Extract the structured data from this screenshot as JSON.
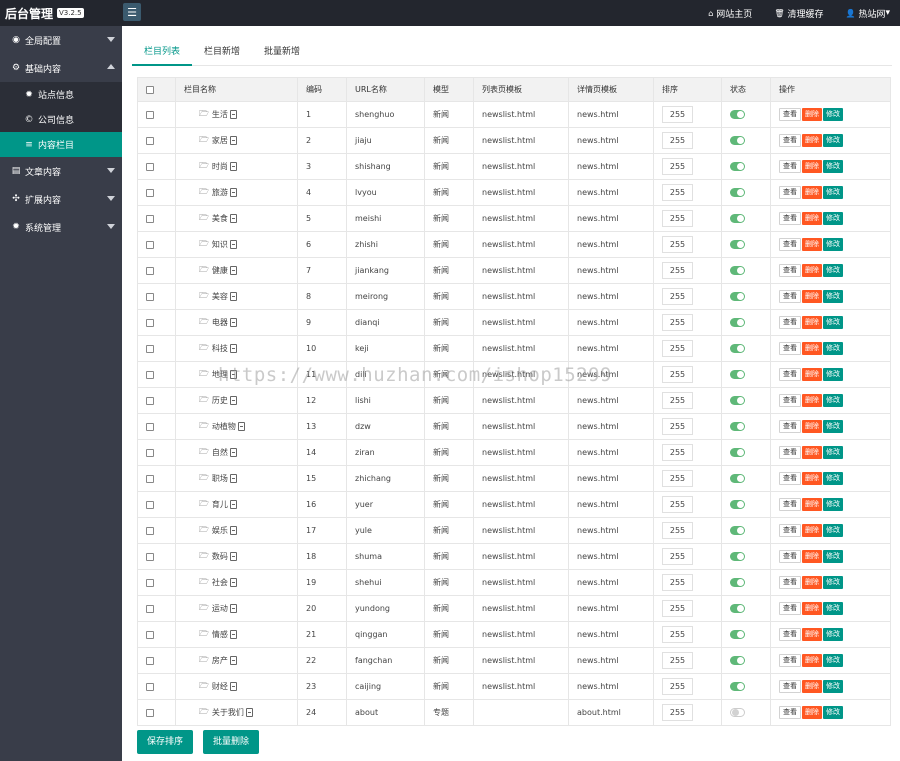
{
  "header": {
    "title": "后台管理",
    "version": "V3.2.5",
    "links": [
      {
        "icon": "home-icon",
        "glyph": "⌂",
        "label": "网站主页"
      },
      {
        "icon": "trash-icon",
        "glyph": "🗑",
        "label": "清理缓存"
      },
      {
        "icon": "user-icon",
        "glyph": "👤",
        "label": "热站网"
      }
    ]
  },
  "sidebar": {
    "items": [
      {
        "label": "全局配置",
        "icon": "globe-icon",
        "glyph": "◉",
        "expanded": false
      },
      {
        "label": "基础内容",
        "icon": "sliders-icon",
        "glyph": "⚙",
        "expanded": true,
        "children": [
          {
            "label": "站点信息",
            "icon": "gear-icon",
            "glyph": "✹",
            "active": false
          },
          {
            "label": "公司信息",
            "icon": "copyright-icon",
            "glyph": "©",
            "active": false
          },
          {
            "label": "内容栏目",
            "icon": "list-icon",
            "glyph": "≡",
            "active": true
          }
        ]
      },
      {
        "label": "文章内容",
        "icon": "file-icon",
        "glyph": "▤",
        "expanded": false
      },
      {
        "label": "扩展内容",
        "icon": "expand-icon",
        "glyph": "✣",
        "expanded": false
      },
      {
        "label": "系统管理",
        "icon": "cog-icon",
        "glyph": "✹",
        "expanded": false
      }
    ]
  },
  "tabs": [
    "栏目列表",
    "栏目新增",
    "批量新增"
  ],
  "table": {
    "headers": [
      "栏目名称",
      "编码",
      "URL名称",
      "模型",
      "列表页模板",
      "详情页模板",
      "排序",
      "状态",
      "操作"
    ],
    "actions": {
      "view": "查看",
      "delete": "删除",
      "edit": "修改"
    },
    "rows": [
      {
        "name": "生活",
        "code": "1",
        "url": "shenghuo",
        "model": "新闻",
        "list_tpl": "newslist.html",
        "detail_tpl": "news.html",
        "sort": "255",
        "enabled": true
      },
      {
        "name": "家居",
        "code": "2",
        "url": "jiaju",
        "model": "新闻",
        "list_tpl": "newslist.html",
        "detail_tpl": "news.html",
        "sort": "255",
        "enabled": true
      },
      {
        "name": "时尚",
        "code": "3",
        "url": "shishang",
        "model": "新闻",
        "list_tpl": "newslist.html",
        "detail_tpl": "news.html",
        "sort": "255",
        "enabled": true
      },
      {
        "name": "旅游",
        "code": "4",
        "url": "lvyou",
        "model": "新闻",
        "list_tpl": "newslist.html",
        "detail_tpl": "news.html",
        "sort": "255",
        "enabled": true
      },
      {
        "name": "美食",
        "code": "5",
        "url": "meishi",
        "model": "新闻",
        "list_tpl": "newslist.html",
        "detail_tpl": "news.html",
        "sort": "255",
        "enabled": true
      },
      {
        "name": "知识",
        "code": "6",
        "url": "zhishi",
        "model": "新闻",
        "list_tpl": "newslist.html",
        "detail_tpl": "news.html",
        "sort": "255",
        "enabled": true
      },
      {
        "name": "健康",
        "code": "7",
        "url": "jiankang",
        "model": "新闻",
        "list_tpl": "newslist.html",
        "detail_tpl": "news.html",
        "sort": "255",
        "enabled": true
      },
      {
        "name": "美容",
        "code": "8",
        "url": "meirong",
        "model": "新闻",
        "list_tpl": "newslist.html",
        "detail_tpl": "news.html",
        "sort": "255",
        "enabled": true
      },
      {
        "name": "电器",
        "code": "9",
        "url": "dianqi",
        "model": "新闻",
        "list_tpl": "newslist.html",
        "detail_tpl": "news.html",
        "sort": "255",
        "enabled": true
      },
      {
        "name": "科技",
        "code": "10",
        "url": "keji",
        "model": "新闻",
        "list_tpl": "newslist.html",
        "detail_tpl": "news.html",
        "sort": "255",
        "enabled": true
      },
      {
        "name": "地理",
        "code": "11",
        "url": "dili",
        "model": "新闻",
        "list_tpl": "newslist.html",
        "detail_tpl": "news.html",
        "sort": "255",
        "enabled": true
      },
      {
        "name": "历史",
        "code": "12",
        "url": "lishi",
        "model": "新闻",
        "list_tpl": "newslist.html",
        "detail_tpl": "news.html",
        "sort": "255",
        "enabled": true
      },
      {
        "name": "动植物",
        "code": "13",
        "url": "dzw",
        "model": "新闻",
        "list_tpl": "newslist.html",
        "detail_tpl": "news.html",
        "sort": "255",
        "enabled": true
      },
      {
        "name": "自然",
        "code": "14",
        "url": "ziran",
        "model": "新闻",
        "list_tpl": "newslist.html",
        "detail_tpl": "news.html",
        "sort": "255",
        "enabled": true
      },
      {
        "name": "职场",
        "code": "15",
        "url": "zhichang",
        "model": "新闻",
        "list_tpl": "newslist.html",
        "detail_tpl": "news.html",
        "sort": "255",
        "enabled": true
      },
      {
        "name": "育儿",
        "code": "16",
        "url": "yuer",
        "model": "新闻",
        "list_tpl": "newslist.html",
        "detail_tpl": "news.html",
        "sort": "255",
        "enabled": true
      },
      {
        "name": "娱乐",
        "code": "17",
        "url": "yule",
        "model": "新闻",
        "list_tpl": "newslist.html",
        "detail_tpl": "news.html",
        "sort": "255",
        "enabled": true
      },
      {
        "name": "数码",
        "code": "18",
        "url": "shuma",
        "model": "新闻",
        "list_tpl": "newslist.html",
        "detail_tpl": "news.html",
        "sort": "255",
        "enabled": true
      },
      {
        "name": "社会",
        "code": "19",
        "url": "shehui",
        "model": "新闻",
        "list_tpl": "newslist.html",
        "detail_tpl": "news.html",
        "sort": "255",
        "enabled": true
      },
      {
        "name": "运动",
        "code": "20",
        "url": "yundong",
        "model": "新闻",
        "list_tpl": "newslist.html",
        "detail_tpl": "news.html",
        "sort": "255",
        "enabled": true
      },
      {
        "name": "情感",
        "code": "21",
        "url": "qinggan",
        "model": "新闻",
        "list_tpl": "newslist.html",
        "detail_tpl": "news.html",
        "sort": "255",
        "enabled": true
      },
      {
        "name": "房产",
        "code": "22",
        "url": "fangchan",
        "model": "新闻",
        "list_tpl": "newslist.html",
        "detail_tpl": "news.html",
        "sort": "255",
        "enabled": true
      },
      {
        "name": "财经",
        "code": "23",
        "url": "caijing",
        "model": "新闻",
        "list_tpl": "newslist.html",
        "detail_tpl": "news.html",
        "sort": "255",
        "enabled": true
      },
      {
        "name": "关于我们",
        "code": "24",
        "url": "about",
        "model": "专题",
        "list_tpl": "",
        "detail_tpl": "about.html",
        "sort": "255",
        "enabled": false
      }
    ]
  },
  "footer": {
    "save_sort": "保存排序",
    "batch_delete": "批量删除"
  },
  "watermark": "https://www.huzhan.com/ishop15299",
  "colors": {
    "accent": "#009688",
    "danger": "#ff5722",
    "sidebar": "#393d49",
    "topbar": "#23262e",
    "switch_on": "#5fb878"
  }
}
